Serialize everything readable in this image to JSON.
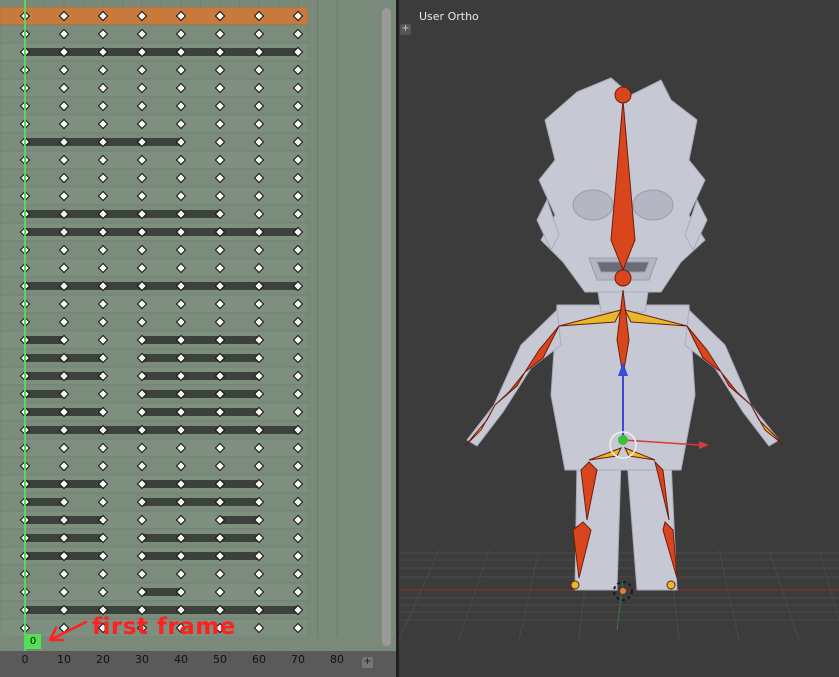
{
  "viewport": {
    "label": "User Ortho",
    "plus_glyph": "+"
  },
  "dopesheet": {
    "annotation_text": "first frame",
    "current_frame": "0",
    "plus_glyph": "+",
    "ruler_ticks": [
      "0",
      "10",
      "20",
      "30",
      "40",
      "50",
      "60",
      "70",
      "80"
    ],
    "keyframe_columns": [
      0,
      10,
      20,
      30,
      40,
      50,
      60,
      70
    ],
    "selected_channel_index": 0,
    "channels": [
      {
        "holds": []
      },
      {
        "holds": []
      },
      {
        "holds": [
          [
            0,
            70
          ]
        ]
      },
      {
        "holds": []
      },
      {
        "holds": []
      },
      {
        "holds": []
      },
      {
        "holds": []
      },
      {
        "holds": [
          [
            0,
            40
          ]
        ]
      },
      {
        "holds": []
      },
      {
        "holds": []
      },
      {
        "holds": []
      },
      {
        "holds": [
          [
            0,
            50
          ]
        ]
      },
      {
        "holds": [
          [
            0,
            70
          ]
        ]
      },
      {
        "holds": []
      },
      {
        "holds": []
      },
      {
        "holds": [
          [
            0,
            70
          ]
        ]
      },
      {
        "holds": []
      },
      {
        "holds": []
      },
      {
        "holds": [
          [
            0,
            10
          ],
          [
            30,
            60
          ]
        ]
      },
      {
        "holds": [
          [
            0,
            20
          ],
          [
            30,
            60
          ]
        ]
      },
      {
        "holds": [
          [
            0,
            20
          ],
          [
            30,
            60
          ]
        ]
      },
      {
        "holds": [
          [
            0,
            10
          ],
          [
            30,
            60
          ]
        ]
      },
      {
        "holds": [
          [
            0,
            20
          ],
          [
            30,
            60
          ]
        ]
      },
      {
        "holds": [
          [
            0,
            70
          ]
        ]
      },
      {
        "holds": []
      },
      {
        "holds": []
      },
      {
        "holds": [
          [
            0,
            20
          ],
          [
            30,
            60
          ]
        ]
      },
      {
        "holds": [
          [
            0,
            10
          ],
          [
            30,
            60
          ]
        ]
      },
      {
        "holds": [
          [
            0,
            20
          ],
          [
            50,
            60
          ]
        ]
      },
      {
        "holds": [
          [
            0,
            20
          ],
          [
            30,
            60
          ]
        ]
      },
      {
        "holds": [
          [
            0,
            20
          ],
          [
            30,
            60
          ]
        ]
      },
      {
        "holds": []
      },
      {
        "holds": [
          [
            30,
            40
          ]
        ]
      },
      {
        "holds": [
          [
            0,
            70
          ]
        ]
      },
      {
        "holds": []
      }
    ]
  },
  "colors": {
    "selected_row": "#c87a3c",
    "current_frame_line": "#5ad65a",
    "bone": "#d9461e",
    "bone_selected": "#e8b82a",
    "mesh": "#c9cbd6"
  }
}
